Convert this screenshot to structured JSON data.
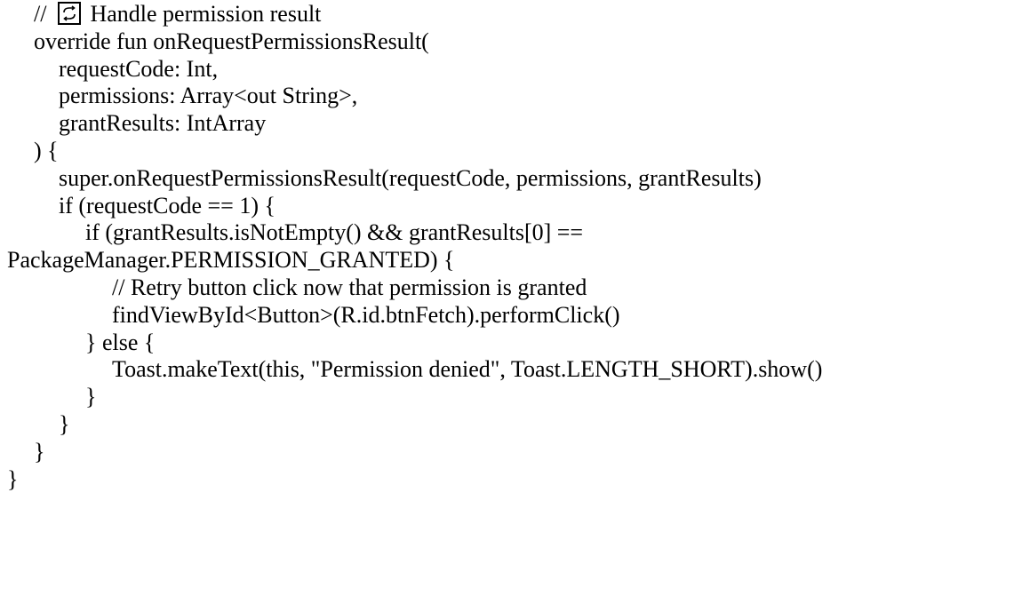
{
  "lines": [
    {
      "indent": 1,
      "parts": [
        {
          "t": "// "
        },
        {
          "icon": "refresh-icon"
        },
        {
          "t": " Handle permission result"
        }
      ]
    },
    {
      "indent": 1,
      "parts": [
        {
          "t": "override fun onRequestPermissionsResult("
        }
      ]
    },
    {
      "indent": 2,
      "parts": [
        {
          "t": "requestCode: Int,"
        }
      ]
    },
    {
      "indent": 2,
      "parts": [
        {
          "t": "permissions: Array<out String>,"
        }
      ]
    },
    {
      "indent": 2,
      "parts": [
        {
          "t": "grantResults: IntArray"
        }
      ]
    },
    {
      "indent": 1,
      "parts": [
        {
          "t": ") {"
        }
      ]
    },
    {
      "indent": 2,
      "parts": [
        {
          "t": "super.onRequestPermissionsResult(requestCode, permissions, grantResults)"
        }
      ]
    },
    {
      "indent": 2,
      "parts": [
        {
          "t": "if (requestCode == 1) {"
        }
      ]
    },
    {
      "indent": 3,
      "parts": [
        {
          "t": "if (grantResults.isNotEmpty() && grantResults[0] =="
        }
      ]
    },
    {
      "indent": 0,
      "parts": [
        {
          "t": "PackageManager.PERMISSION_GRANTED) {"
        }
      ]
    },
    {
      "indent": 4,
      "parts": [
        {
          "t": "// Retry button click now that permission is granted"
        }
      ]
    },
    {
      "indent": 4,
      "parts": [
        {
          "t": "findViewById<Button>(R.id.btnFetch).performClick()"
        }
      ]
    },
    {
      "indent": 3,
      "parts": [
        {
          "t": "} else {"
        }
      ]
    },
    {
      "indent": 4,
      "parts": [
        {
          "t": "Toast.makeText(this, \"Permission denied\", Toast.LENGTH_SHORT).show()"
        }
      ]
    },
    {
      "indent": 3,
      "parts": [
        {
          "t": "}"
        }
      ]
    },
    {
      "indent": 2,
      "parts": [
        {
          "t": "}"
        }
      ]
    },
    {
      "indent": 1,
      "parts": [
        {
          "t": "}"
        }
      ]
    },
    {
      "indent": 0,
      "parts": [
        {
          "t": "}"
        }
      ]
    }
  ]
}
